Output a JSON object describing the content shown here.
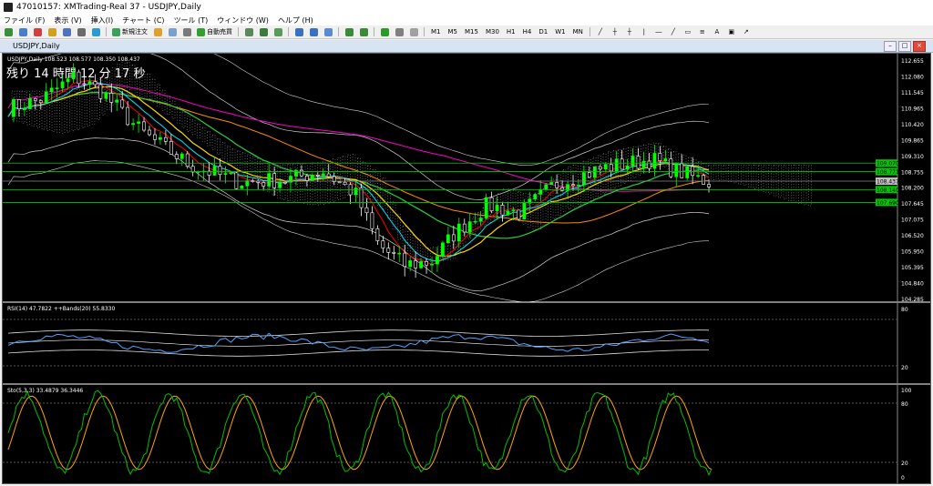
{
  "window": {
    "title": "47010157: XMTrading-Real 37 - USDJPY,Daily"
  },
  "menu": [
    "ファイル (F)",
    "表示 (V)",
    "挿入(I)",
    "チャート (C)",
    "ツール (T)",
    "ウィンドウ (W)",
    "ヘルプ (H)"
  ],
  "toolbar": {
    "new_order": "新規注文",
    "auto_trading": "自動売買",
    "timeframes": [
      "M1",
      "M5",
      "M15",
      "M30",
      "H1",
      "H4",
      "D1",
      "W1",
      "MN"
    ],
    "text_tool": "A"
  },
  "chart_window": {
    "title": "USDJPY,Daily"
  },
  "main_chart": {
    "header": "USDJPY,Daily 108.523 108.577 108.350 108.437",
    "countdown": "残り 14 時間 12 分 17 秒",
    "price_ticks": [
      "112.655",
      "112.080",
      "111.545",
      "110.965",
      "110.420",
      "109.865",
      "109.310",
      "108.755",
      "108.200",
      "107.645",
      "107.075",
      "106.520",
      "105.950",
      "105.395",
      "104.840",
      "104.285"
    ],
    "price_labels": [
      {
        "text": "109.070",
        "color": "#00c800"
      },
      {
        "text": "108.771",
        "color": "#00c800"
      },
      {
        "text": "108.437",
        "color": "#c0c0c0"
      },
      {
        "text": "108.140",
        "color": "#00c800"
      },
      {
        "text": "107.690",
        "color": "#00c800"
      }
    ]
  },
  "rsi_panel": {
    "header": "RSI(14) 47.7822 ++Bands(20) 55.8330",
    "ticks": [
      "80",
      "20"
    ]
  },
  "stoch_panel": {
    "header": "Sto(5,3,3) 33.4879 36.3446",
    "ticks": [
      "100",
      "80",
      "20",
      "0"
    ]
  },
  "colors": {
    "bull": "#00ff00",
    "bear": "#ffffff",
    "ma_red": "#ff0000",
    "ma_yellow": "#ffd700",
    "ma_orange": "#ff8c00",
    "ma_green": "#2ecc40",
    "ma_cyan": "#00e5ff",
    "ma_magenta": "#ff00c8",
    "stoch_main": "#00c000",
    "stoch_signal": "#ffa500",
    "rsi": "#4fa3ff"
  }
}
